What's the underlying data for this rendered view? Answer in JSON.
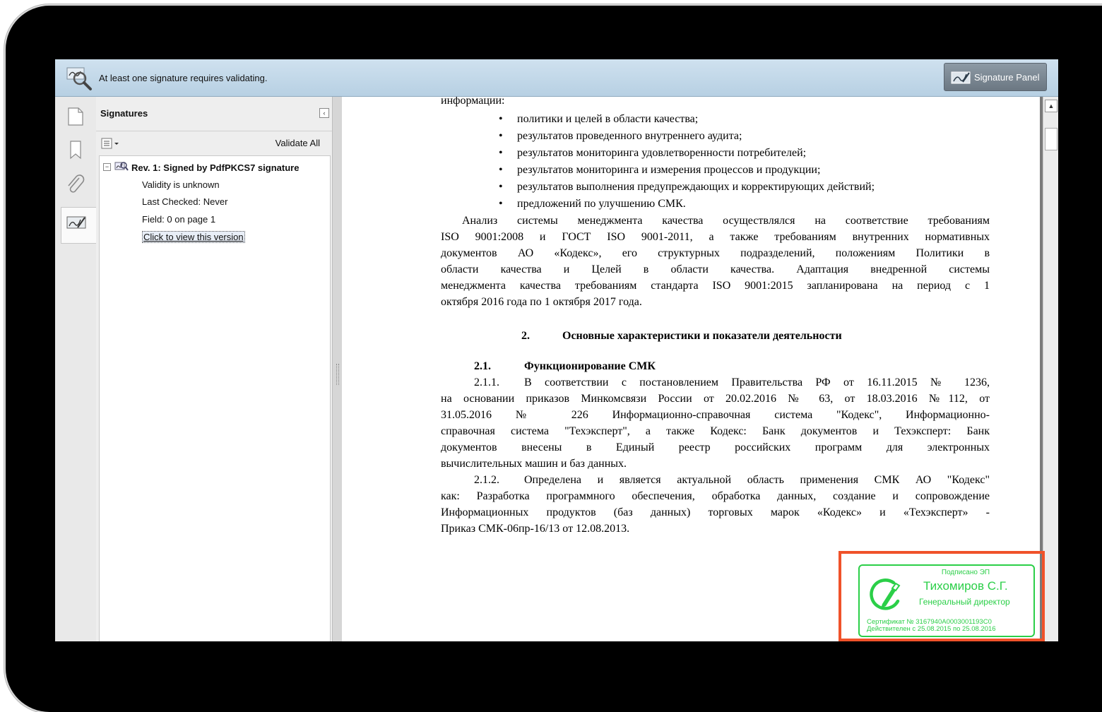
{
  "message_bar": {
    "text": "At least one signature requires validating.",
    "signature_panel_button": "Signature Panel"
  },
  "signatures_panel": {
    "title": "Signatures",
    "validate_all": "Validate All",
    "revision": {
      "label": "Rev. 1: Signed by PdfPKCS7 signature",
      "validity": "Validity is unknown",
      "last_checked": "Last Checked: Never",
      "field": "Field: 0 on page 1",
      "view_link": "Click to view this version"
    }
  },
  "document": {
    "top_line": "информации:",
    "bullets": [
      "политики и целей в области качества;",
      "результатов проведенного внутреннего аудита;",
      "результатов мониторинга удовлетворенности потребителей;",
      "результатов мониторинга и измерения процессов и продукции;",
      "результатов выполнения предупреждающих и корректирующих действий;",
      "предложений по улучшению СМК."
    ],
    "paragraph1": [
      "Анализ системы менеджмента качества осуществлялся на соответствие требованиям",
      "ISO 9001:2008 и ГОСТ ISO 9001-2011, а также требованиям внутренних нормативных",
      "документов АО «Кодекс», его структурных подразделений, положениям Политики в",
      "области качества и Целей в области качества. Адаптация внедренной системы",
      "менеджмента качества требованиям стандарта ISO 9001:2015 запланирована на период с 1",
      "октября 2016 года по 1 октября 2017 года."
    ],
    "section_number": "2.",
    "section_title": "Основные характеристики и показатели деятельности",
    "subsection_number": "2.1.",
    "subsection_title": "Функционирование СМК",
    "para_211_number": "2.1.1.",
    "para_211": [
      "В соответствии с постановлением Правительства РФ от 16.11.2015 № 1236,",
      "на основании приказов Минкомсвязи России от 20.02.2016 № 63, от 18.03.2016 №112, от",
      "31.05.2016 № 226 Информационно-справочная система \"Кодекс\", Информационно-",
      "справочная система \"Техэксперт\", а также Кодекс: Банк документов и Техэксперт: Банк",
      "документов внесены в Единый реестр российских программ для электронных",
      "вычислительных машин и баз данных."
    ],
    "para_212_number": "2.1.2.",
    "para_212": [
      "Определена и является актуальной область применения СМК АО \"Кодекс\"",
      "как: Разработка программного обеспечения, обработка данных, создание и сопровождение",
      "Информационных продуктов (баз данных) торговых марок «Кодекс» и «Техэксперт» -",
      "Приказ СМК-06пр-16/13 от 12.08.2013."
    ]
  },
  "stamp": {
    "caption": "Подписано ЭП",
    "name": "Тихомиров С.Г.",
    "position": "Генеральный директор",
    "cert_line1": "Сертификат № 3167940А0003001193С0",
    "cert_line2": "Действителен с 25.08.2015 по 25.08.2016",
    "color": "#2bcf48",
    "highlight_color": "#f0522a"
  },
  "icons": [
    "magnifier-signature-icon",
    "signature-pen-icon",
    "pages-icon",
    "bookmark-icon",
    "paperclip-icon",
    "signatures-icon",
    "options-icon",
    "expand-minus-icon",
    "signature-rev-icon",
    "scroll-up-arrow-icon",
    "stamp-logo-icon"
  ]
}
